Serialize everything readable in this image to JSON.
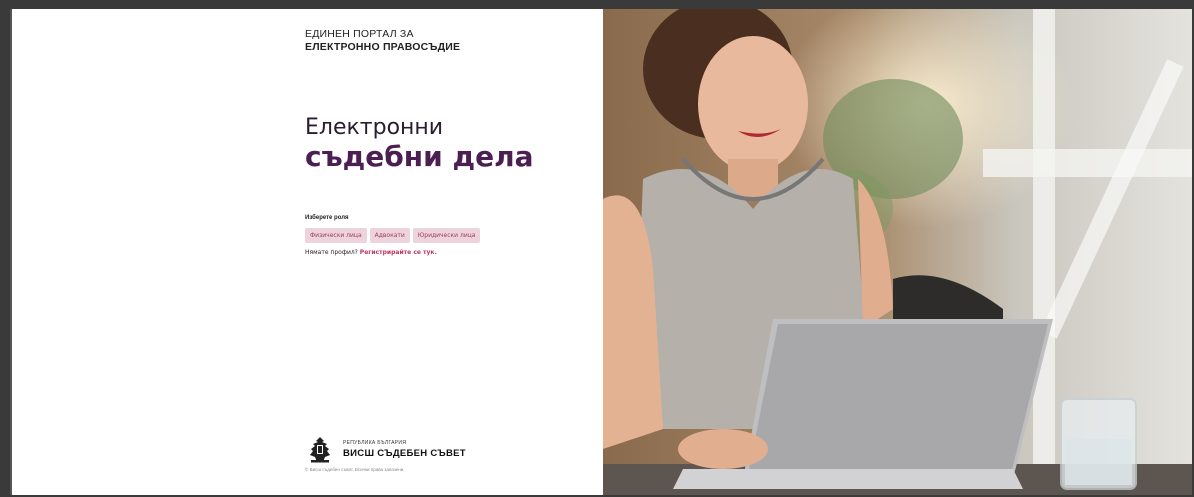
{
  "portal": {
    "line1": "ЕДИНЕН ПОРТАЛ ЗА",
    "line2": "ЕЛЕКТРОННО ПРАВОСЪДИЕ"
  },
  "headline": {
    "line1": "Електронни",
    "line2": "съдебни дела"
  },
  "roles": {
    "label": "Изберете роля",
    "options": [
      "Физически лица",
      "Адвокати",
      "Юридически лица"
    ]
  },
  "no_profile": {
    "text": "Нямате профил?",
    "link": "Регистрирайте се тук."
  },
  "footer": {
    "country": "РЕПУБЛИКА БЪЛГАРИЯ",
    "council": "ВИСШ СЪДЕБЕН СЪВЕТ",
    "copyright": "© Висш съдебен съвет. Всички права запазени."
  },
  "colors": {
    "brand_purple": "#4b1f52",
    "accent_pink": "#c2335e",
    "role_button_bg": "#ecd3dc"
  }
}
